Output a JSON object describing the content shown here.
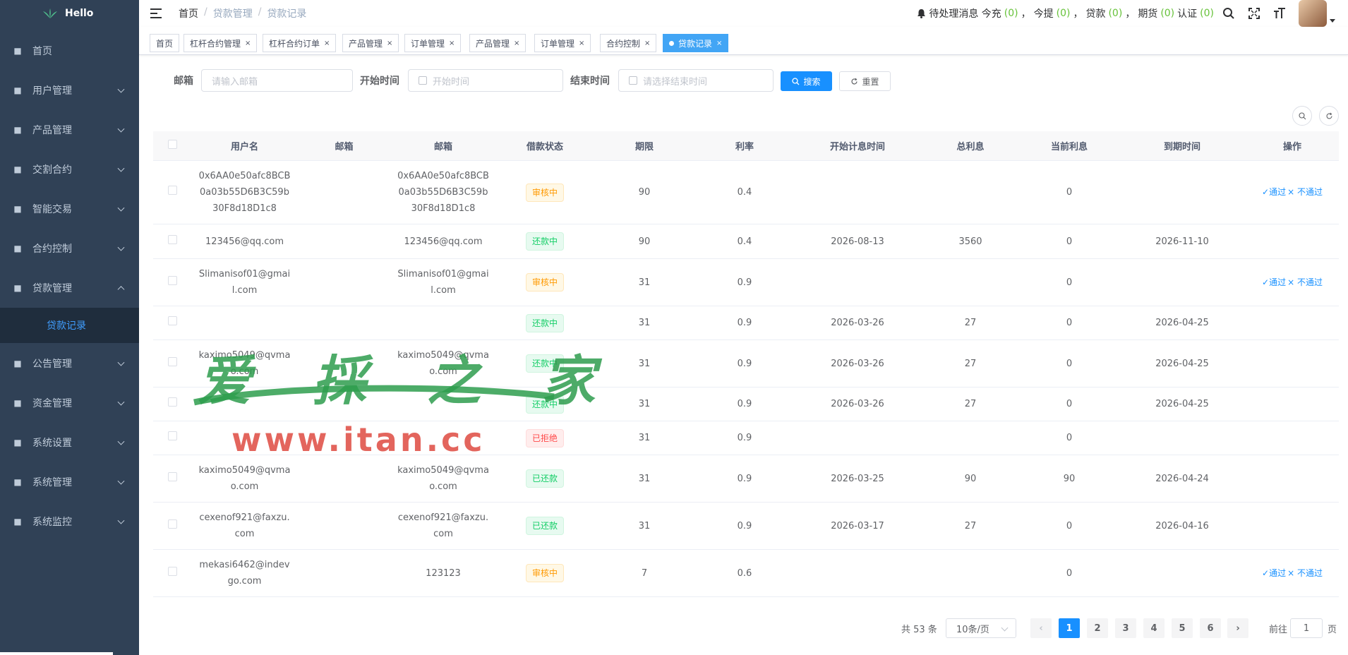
{
  "app": {
    "logo_text": "Hello"
  },
  "sidebar": {
    "items": [
      {
        "label": "首页",
        "icon": "dashboard-icon",
        "has_arrow": false
      },
      {
        "label": "用户管理",
        "icon": "user-icon",
        "has_arrow": true
      },
      {
        "label": "产品管理",
        "icon": "document-icon",
        "has_arrow": true
      },
      {
        "label": "交割合约",
        "icon": "chart-icon",
        "has_arrow": true
      },
      {
        "label": "智能交易",
        "icon": "gear-icon",
        "has_arrow": true
      },
      {
        "label": "合约控制",
        "icon": "bar-chart-icon",
        "has_arrow": true
      },
      {
        "label": "贷款管理",
        "icon": "money-icon",
        "has_arrow": true,
        "expanded": true
      },
      {
        "label": "公告管理",
        "icon": "message-icon",
        "has_arrow": true
      },
      {
        "label": "资金管理",
        "icon": "wallet-icon",
        "has_arrow": true
      },
      {
        "label": "系统设置",
        "icon": "settings-icon",
        "has_arrow": true
      },
      {
        "label": "系统管理",
        "icon": "system-icon",
        "has_arrow": true
      },
      {
        "label": "系统监控",
        "icon": "monitor-icon",
        "has_arrow": true
      }
    ],
    "active_sub": "贷款记录"
  },
  "header": {
    "breadcrumb": [
      "首页",
      "贷款管理",
      "贷款记录"
    ],
    "notice": {
      "label": "待处理消息 今充",
      "recharge_count": "(0)",
      "withdraw_label": "今提",
      "withdraw_count": "(0)",
      "loan_label": "贷款",
      "loan_count": "(0)",
      "futures_label": "期货",
      "futures_count": "(0)",
      "auth_label": "认证",
      "auth_count": "(0)",
      "comma": "，"
    }
  },
  "tags": [
    {
      "label": "首页",
      "closable": false
    },
    {
      "label": "杠杆合约管理",
      "closable": true
    },
    {
      "label": "杠杆合约订单",
      "closable": true
    },
    {
      "label": "产品管理",
      "closable": true
    },
    {
      "label": "订单管理",
      "closable": true
    },
    {
      "label": "产品管理",
      "closable": true
    },
    {
      "label": "订单管理",
      "closable": true
    },
    {
      "label": "合约控制",
      "closable": true
    },
    {
      "label": "贷款记录",
      "closable": true,
      "active": true
    }
  ],
  "search": {
    "email_label": "邮箱",
    "email_placeholder": "请输入邮箱",
    "start_label": "开始时间",
    "start_placeholder": "开始时间",
    "end_label": "结束时间",
    "end_placeholder": "请选择结束时间",
    "search_button": "搜索",
    "reset_button": "重置"
  },
  "table": {
    "columns": [
      "用户名",
      "邮箱",
      "邮箱",
      "借款状态",
      "期限",
      "利率",
      "开始计息时间",
      "总利息",
      "当前利息",
      "到期时间",
      "操作"
    ],
    "rows": [
      {
        "username": "0x6AA0e50afc8BCB0a03b55D6B3C59b30F8d18D1c8",
        "email1": "",
        "email2": "0x6AA0e50afc8BCB0a03b55D6B3C59b30F8d18D1c8",
        "status": "审核中",
        "status_type": "warn",
        "term": "90",
        "rate": "0.4",
        "start": "",
        "total": "",
        "current": "0",
        "due": "",
        "actions": true
      },
      {
        "username": "123456@qq.com",
        "email1": "",
        "email2": "123456@qq.com",
        "status": "还款中",
        "status_type": "ok",
        "term": "90",
        "rate": "0.4",
        "start": "2026-08-13",
        "total": "3560",
        "current": "0",
        "due": "2026-11-10",
        "actions": false
      },
      {
        "username": "Slimanisof01@gmail.com",
        "email1": "",
        "email2": "Slimanisof01@gmail.com",
        "status": "审核中",
        "status_type": "warn",
        "term": "31",
        "rate": "0.9",
        "start": "",
        "total": "",
        "current": "0",
        "due": "",
        "actions": true
      },
      {
        "username": "",
        "email1": "",
        "email2": "",
        "status": "还款中",
        "status_type": "ok",
        "term": "31",
        "rate": "0.9",
        "start": "2026-03-26",
        "total": "27",
        "current": "0",
        "due": "2026-04-25",
        "actions": false
      },
      {
        "username": "kaximo5049@qvmao.com",
        "email1": "",
        "email2": "kaximo5049@qvmao.com",
        "status": "还款中",
        "status_type": "ok",
        "term": "31",
        "rate": "0.9",
        "start": "2026-03-26",
        "total": "27",
        "current": "0",
        "due": "2026-04-25",
        "actions": false
      },
      {
        "username": "",
        "email1": "",
        "email2": "",
        "status": "还款中",
        "status_type": "ok",
        "term": "31",
        "rate": "0.9",
        "start": "2026-03-26",
        "total": "27",
        "current": "0",
        "due": "2026-04-25",
        "actions": false
      },
      {
        "username": "",
        "email1": "",
        "email2": "",
        "status": "已拒绝",
        "status_type": "err",
        "term": "31",
        "rate": "0.9",
        "start": "",
        "total": "",
        "current": "0",
        "due": "",
        "actions": false
      },
      {
        "username": "kaximo5049@qvmao.com",
        "email1": "",
        "email2": "kaximo5049@qvmao.com",
        "status": "已还款",
        "status_type": "ok",
        "term": "31",
        "rate": "0.9",
        "start": "2026-03-25",
        "total": "90",
        "current": "90",
        "due": "2026-04-24",
        "actions": false
      },
      {
        "username": "cexenof921@faxzu.com",
        "email1": "",
        "email2": "cexenof921@faxzu.com",
        "status": "已还款",
        "status_type": "ok",
        "term": "31",
        "rate": "0.9",
        "start": "2026-03-17",
        "total": "27",
        "current": "0",
        "due": "2026-04-16",
        "actions": false
      },
      {
        "username": "mekasi6462@indevgo.com",
        "email1": "",
        "email2": "123123",
        "status": "审核中",
        "status_type": "warn",
        "term": "7",
        "rate": "0.6",
        "start": "",
        "total": "",
        "current": "0",
        "due": "",
        "actions": true
      }
    ],
    "approve_label": "✓通过",
    "reject_label": "× 不通过"
  },
  "pagination": {
    "total_text": "共 53 条",
    "page_size": "10条/页",
    "pages": [
      "1",
      "2",
      "3",
      "4",
      "5",
      "6"
    ],
    "current_page": "1",
    "goto_label": "前往",
    "goto_value": "1",
    "page_suffix": "页"
  },
  "watermark": {
    "text1": "爱 採 之 家",
    "text2": "www.itan.cc"
  },
  "colors": {
    "primary": "#1890ff",
    "sidebar_bg": "#304156",
    "success": "#13ce66",
    "warning": "#ff9900",
    "danger": "#ff4949"
  }
}
